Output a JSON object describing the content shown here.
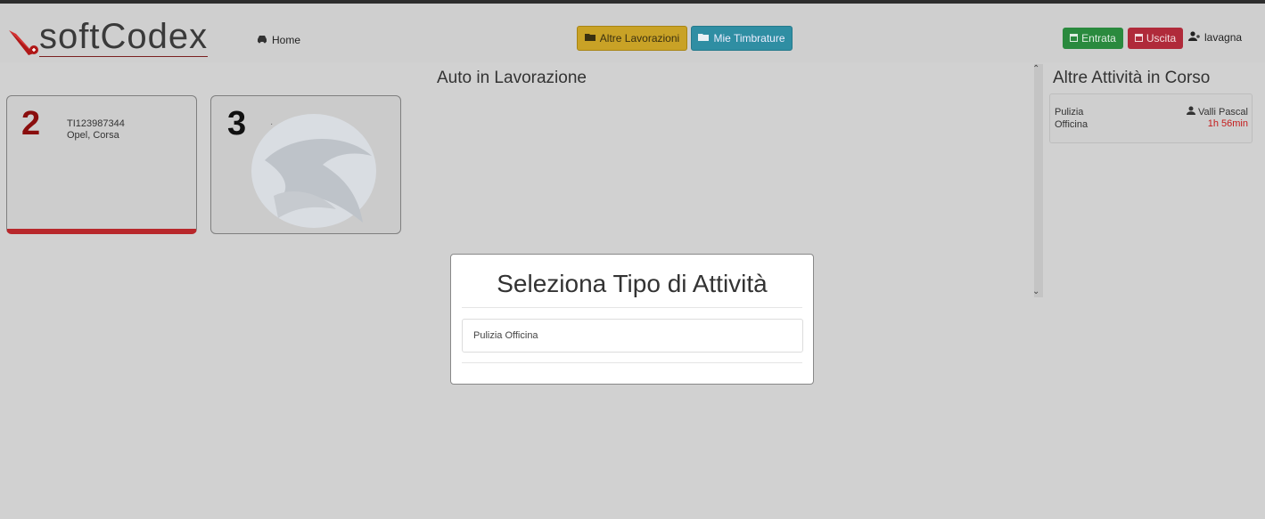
{
  "header": {
    "logo_text": "softCodex",
    "home_label": "Home",
    "altre_label": "Altre Lavorazioni",
    "mie_label": "Mie Timbrature",
    "entrata_label": "Entrata",
    "uscita_label": "Uscita",
    "user_label": "lavagna"
  },
  "main": {
    "title": "Auto in Lavorazione",
    "cards": [
      {
        "number": "2",
        "plate": "TI123987344",
        "model": "Opel, Corsa",
        "status_color": "#b8272b"
      },
      {
        "number": "3",
        "plate": "",
        "model": ""
      }
    ]
  },
  "sidebar": {
    "title": "Altre Attività in Corso",
    "items": [
      {
        "activity_line1": "Pulizia",
        "activity_line2": "Officina",
        "person": "Valli Pascal",
        "elapsed": "1h 56min"
      }
    ]
  },
  "modal": {
    "title": "Seleziona Tipo di Attività",
    "options": [
      "Pulizia Officina"
    ]
  },
  "icons": {
    "home": "car-icon",
    "altre": "folder-open-icon",
    "mie": "folder-open-icon",
    "entrata": "calendar-icon",
    "uscita": "calendar-icon",
    "user": "users-icon",
    "person": "user-icon"
  },
  "colors": {
    "altre_bg": "#c9a226",
    "mie_bg": "#2f8ea3",
    "entrata_bg": "#2a8a3e",
    "uscita_bg": "#b02a3a",
    "elapsed_text": "#c41c1c",
    "card_number_red": "#8a0e0e"
  }
}
